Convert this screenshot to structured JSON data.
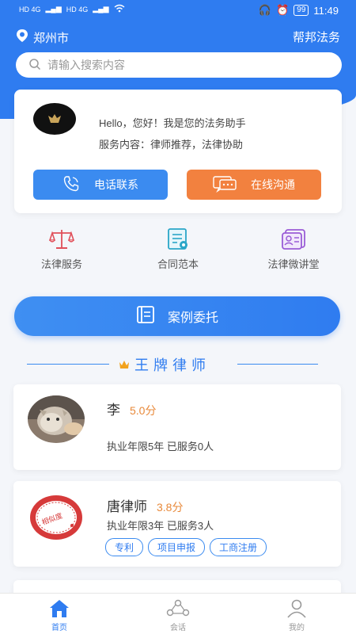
{
  "status_bar": {
    "left_labels": [
      "HD 4G",
      "HD 4G"
    ],
    "battery": "99",
    "time": "11:49"
  },
  "top_bar": {
    "city": "郑州市",
    "brand": "帮邦法务"
  },
  "search": {
    "placeholder": "请输入搜索内容"
  },
  "assistant": {
    "hello": "Hello，您好！我是您的法务助手",
    "service": "服务内容：律师推荐，法律协助",
    "call_label": "电话联系",
    "chat_label": "在线沟通"
  },
  "features": [
    {
      "label": "法律服务",
      "icon": "scales-icon"
    },
    {
      "label": "合同范本",
      "icon": "document-icon"
    },
    {
      "label": "法律微讲堂",
      "icon": "lecture-icon"
    }
  ],
  "case_button": {
    "label": "案例委托"
  },
  "section": {
    "title": "王牌律师"
  },
  "lawyers": [
    {
      "name": "李",
      "score": "5.0分",
      "meta": "执业年限5年 已服务0人",
      "tags": []
    },
    {
      "name": "唐律师",
      "score": "3.8分",
      "meta": "执业年限3年 已服务3人",
      "tags": [
        "专利",
        "项目申报",
        "工商注册"
      ]
    }
  ],
  "tabs": [
    {
      "label": "首页",
      "active": true
    },
    {
      "label": "会话",
      "active": false
    },
    {
      "label": "我的",
      "active": false
    }
  ],
  "colors": {
    "primary": "#2f7cf0",
    "orange": "#f2813f",
    "score": "#e8893a"
  }
}
